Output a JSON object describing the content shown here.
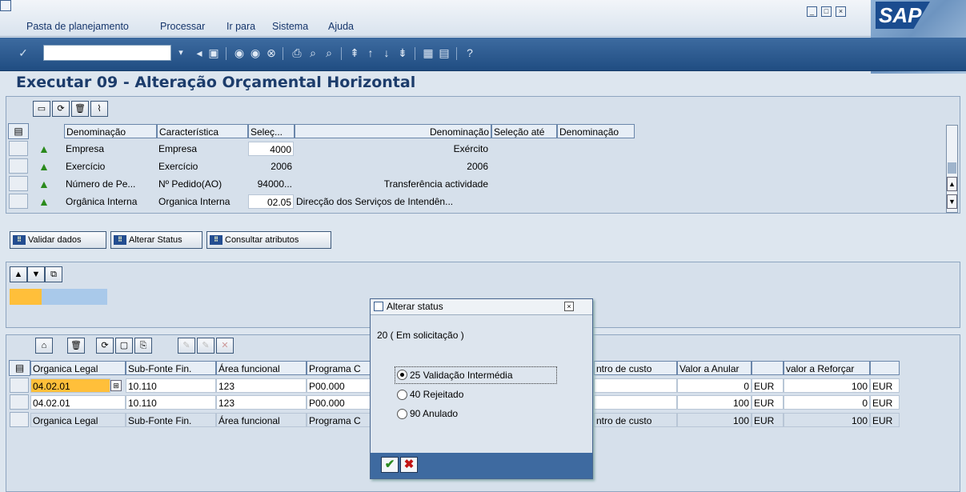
{
  "menu": [
    {
      "label": "Pasta de planejamento"
    },
    {
      "label": "Processar"
    },
    {
      "label": "Ir para"
    },
    {
      "label": "Sistema"
    },
    {
      "label": "Ajuda"
    }
  ],
  "logo": "SAP",
  "page_title": "Executar 09 - Alteração Orçamental Horizontal",
  "selection_grid": {
    "headers": [
      "Denominação",
      "Característica",
      "Seleç...",
      "Denominação",
      "Seleção até",
      "Denominação"
    ],
    "rows": [
      {
        "name": "Empresa",
        "char": "Empresa",
        "sel": "4000",
        "desc": "Exército"
      },
      {
        "name": "Exercício",
        "char": "Exercício",
        "sel": "2006",
        "desc": "2006"
      },
      {
        "name": "Número de Pe...",
        "char": "Nº Pedido(AO)",
        "sel": "94000...",
        "desc": "Transferência actividade"
      },
      {
        "name": "Orgânica Interna",
        "char": "Organica Interna",
        "sel": "02.05",
        "desc": "Direcção dos Serviços de Intendên..."
      }
    ]
  },
  "actions": {
    "validar": "Validar dados",
    "alterar": "Alterar Status",
    "consultar": "Consultar atributos"
  },
  "data_grid": {
    "headers": [
      "Organica Legal",
      "Sub-Fonte Fin.",
      "Área funcional",
      "Programa C",
      "ntro de custo",
      "Valor a Anular",
      "",
      "valor a Reforçar",
      ""
    ],
    "rows": [
      {
        "org": "04.02.01",
        "fonte": "10.110",
        "area": "123",
        "prog": "P00.000",
        "cc": "",
        "anular": "0",
        "cur1": "EUR",
        "reforcar": "100",
        "cur2": "EUR"
      },
      {
        "org": "04.02.01",
        "fonte": "10.110",
        "area": "123",
        "prog": "P00.000",
        "cc": "",
        "anular": "100",
        "cur1": "EUR",
        "reforcar": "0",
        "cur2": "EUR"
      },
      {
        "org": "Organica Legal",
        "fonte": "Sub-Fonte Fin.",
        "area": "Área funcional",
        "prog": "Programa C",
        "cc": "ntro de custo",
        "anular": "100",
        "cur1": "EUR",
        "reforcar": "100",
        "cur2": "EUR"
      }
    ]
  },
  "dialog": {
    "title": "Alterar status",
    "current": "20 ( Em solicitação )",
    "options": [
      {
        "label": "25 Validação Intermédia",
        "selected": true
      },
      {
        "label": "40 Rejeitado",
        "selected": false
      },
      {
        "label": "90 Anulado",
        "selected": false
      }
    ]
  },
  "colors": {
    "toolbar": "#204d82",
    "title": "#1c3c6b",
    "selected_cell": "#ffbf3a",
    "confirm": "#2c8a1f",
    "cancel": "#c21515"
  }
}
